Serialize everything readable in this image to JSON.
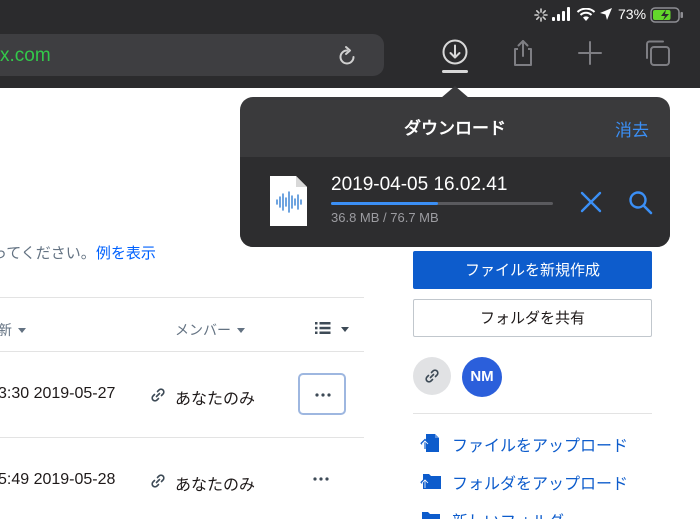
{
  "status_bar": {
    "battery_percent": "73%",
    "battery_level": 0.73,
    "battery_color": "#63d62b"
  },
  "browser": {
    "url_fragment": "x.com",
    "url_color": "#33c94a"
  },
  "downloads_popover": {
    "title": "ダウンロード",
    "clear_label": "消去",
    "item": {
      "filename": "2019-04-05 16.02.41",
      "size_text": "36.8 MB / 76.7 MB",
      "progress": 0.48
    },
    "accent_color": "#3b8ff5"
  },
  "file_list": {
    "hint_text": "ってください。",
    "hint_link": "例を表示",
    "columns": {
      "modified": "新",
      "members": "メンバー"
    },
    "rows": [
      {
        "modified": "3:30 2019-05-27",
        "members": "あなたのみ"
      },
      {
        "modified": "5:49 2019-05-28",
        "members": "あなたのみ"
      }
    ]
  },
  "sidebar": {
    "create_file_label": "ファイルを新規作成",
    "share_folder_label": "フォルダを共有",
    "avatar_initials": "NM",
    "avatar_color": "#2b5fdb",
    "actions": [
      {
        "label": "ファイルをアップロード",
        "icon": "file-upload-icon"
      },
      {
        "label": "フォルダをアップロード",
        "icon": "folder-upload-icon"
      },
      {
        "label": "新しいフォルダ",
        "icon": "new-folder-icon"
      }
    ],
    "primary_color": "#0d5ccc"
  }
}
